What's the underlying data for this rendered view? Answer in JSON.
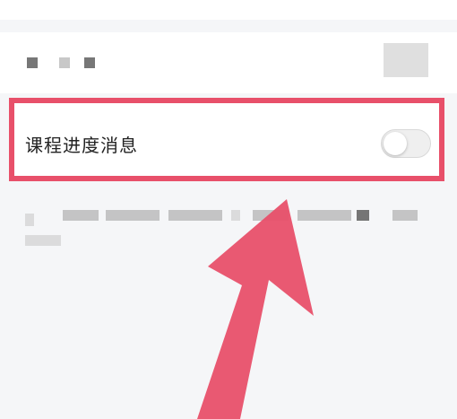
{
  "setting_row": {
    "label": "课程进度消息",
    "toggle_state": "off"
  },
  "accent_color": "#e8506a"
}
